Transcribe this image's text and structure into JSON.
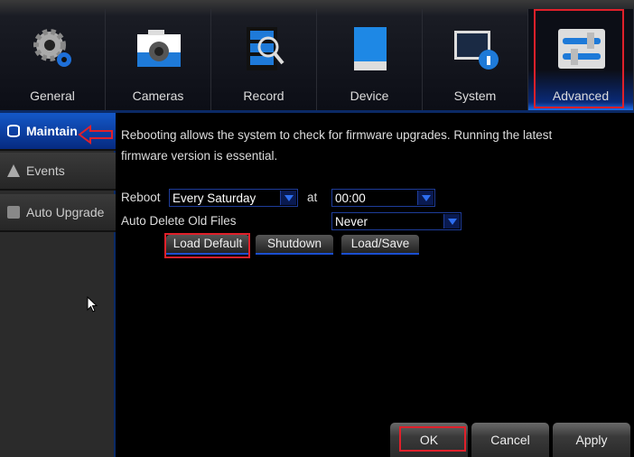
{
  "tabs": [
    {
      "label": "General",
      "icon": "gear-icon"
    },
    {
      "label": "Cameras",
      "icon": "camera-icon"
    },
    {
      "label": "Record",
      "icon": "record-search-icon"
    },
    {
      "label": "Device",
      "icon": "hard-drive-icon"
    },
    {
      "label": "System",
      "icon": "system-info-icon"
    },
    {
      "label": "Advanced",
      "icon": "sliders-icon",
      "active": true
    }
  ],
  "sidebar": {
    "items": [
      {
        "label": "Maintain",
        "icon": "database-icon",
        "active": true
      },
      {
        "label": "Events",
        "icon": "cone-icon"
      },
      {
        "label": "Auto Upgrade",
        "icon": "upgrade-icon"
      }
    ]
  },
  "main": {
    "description": "Rebooting allows the system to check for firmware upgrades. Running the latest firmware version is essential.",
    "reboot_label": "Reboot",
    "reboot_value": "Every Saturday",
    "at_label": "at",
    "time_value": "00:00",
    "auto_delete_label": "Auto Delete Old Files",
    "auto_delete_value": "Never",
    "buttons": {
      "load_default": "Load Default",
      "shutdown": "Shutdown",
      "load_save": "Load/Save"
    }
  },
  "footer": {
    "ok": "OK",
    "cancel": "Cancel",
    "apply": "Apply"
  },
  "colors": {
    "accent": "#1458c8",
    "annotation": "#e0202a"
  }
}
